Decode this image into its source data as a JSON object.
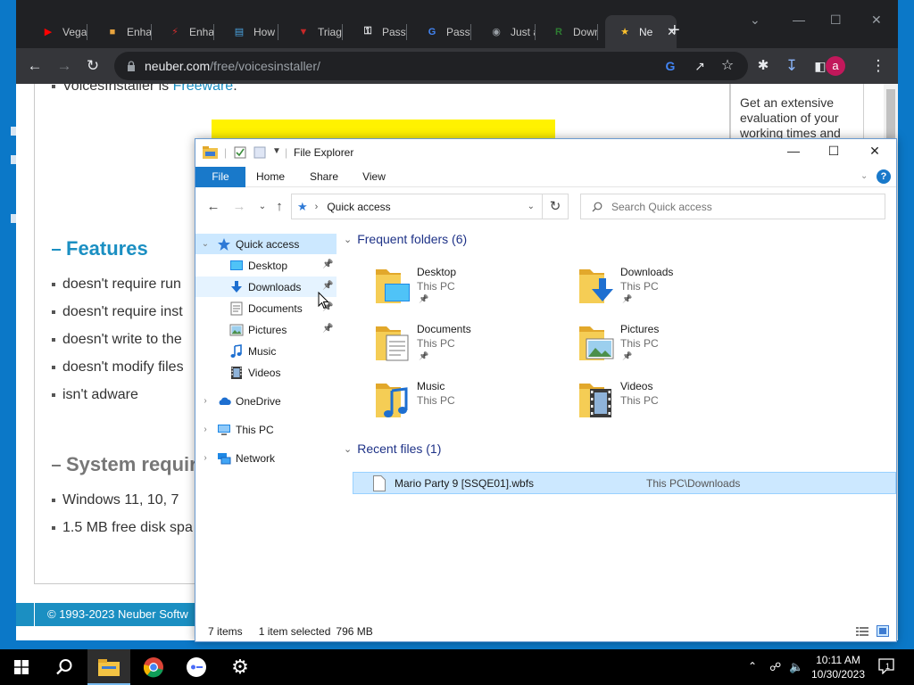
{
  "browser": {
    "tabs": [
      {
        "title": "Vegas",
        "icon": "youtube-icon",
        "color": "#ff0000"
      },
      {
        "title": "Enhan",
        "icon": "app-icon",
        "color": "#e8a33d"
      },
      {
        "title": "Enhan",
        "icon": "app-icon-red",
        "color": "#d32f2f"
      },
      {
        "title": "How I",
        "icon": "monitor-icon",
        "color": "#4aa3df"
      },
      {
        "title": "Triage",
        "icon": "triage-icon",
        "color": "#c62828"
      },
      {
        "title": "Passw",
        "icon": "key-icon",
        "color": "#e8eaed"
      },
      {
        "title": "Passw",
        "icon": "google-icon",
        "color": "#4285f4"
      },
      {
        "title": "Just a",
        "icon": "globe-icon",
        "color": "#9aa0a6"
      },
      {
        "title": "Down",
        "icon": "roms-icon",
        "color": "#2e7d32"
      },
      {
        "title": "Ne",
        "icon": "star-icon",
        "color": "#fbc02d"
      }
    ],
    "url_host": "neuber.com",
    "url_path": "/free/voicesinstaller/",
    "avatar_letter": "a"
  },
  "page": {
    "line_top": "VoicesInstaller is",
    "line_top_link": "Freeware",
    "line_top_end": ".",
    "sidebar_text": "Get an extensive evaluation of your working times and",
    "features_heading": "Features",
    "features": [
      "doesn't require run",
      "doesn't require inst",
      "doesn't write to the",
      "doesn't modify files",
      "isn't adware"
    ],
    "sysreq_heading": "System requir",
    "sysreq": [
      "Windows 11, 10, 7",
      "1.5 MB free disk spa"
    ],
    "footer": "© 1993-2023 Neuber Softw",
    "accent_color": "#1b8fc2"
  },
  "explorer": {
    "title": "File Explorer",
    "ribbon_tabs": [
      "File",
      "Home",
      "Share",
      "View"
    ],
    "address": "Quick access",
    "search_placeholder": "Search Quick access",
    "tree": [
      {
        "label": "Quick access",
        "icon": "star-icon",
        "level": 0
      },
      {
        "label": "Desktop",
        "icon": "desktop-icon",
        "level": 1,
        "pinned": true
      },
      {
        "label": "Downloads",
        "icon": "download-icon",
        "level": 1,
        "pinned": true
      },
      {
        "label": "Documents",
        "icon": "documents-icon",
        "level": 1,
        "pinned": true
      },
      {
        "label": "Pictures",
        "icon": "pictures-icon",
        "level": 1,
        "pinned": true
      },
      {
        "label": "Music",
        "icon": "music-icon",
        "level": 1
      },
      {
        "label": "Videos",
        "icon": "videos-icon",
        "level": 1
      },
      {
        "label": "OneDrive",
        "icon": "cloud-icon",
        "level": 0
      },
      {
        "label": "This PC",
        "icon": "computer-icon",
        "level": 0
      },
      {
        "label": "Network",
        "icon": "network-icon",
        "level": 0
      }
    ],
    "frequent_header": "Frequent folders (6)",
    "frequent": [
      {
        "name": "Desktop",
        "location": "This PC",
        "pinned": true
      },
      {
        "name": "Downloads",
        "location": "This PC",
        "pinned": true
      },
      {
        "name": "Documents",
        "location": "This PC",
        "pinned": true
      },
      {
        "name": "Pictures",
        "location": "This PC",
        "pinned": true
      },
      {
        "name": "Music",
        "location": "This PC",
        "pinned": false
      },
      {
        "name": "Videos",
        "location": "This PC",
        "pinned": false
      }
    ],
    "recent_header": "Recent files (1)",
    "recent": [
      {
        "name": "Mario Party 9 [SSQE01].wbfs",
        "path": "This PC\\Downloads"
      }
    ],
    "status_items": "7 items",
    "status_selected": "1 item selected",
    "status_size": "796 MB"
  },
  "taskbar": {
    "time": "10:11 AM",
    "date": "10/30/2023",
    "notification_count": "1"
  }
}
